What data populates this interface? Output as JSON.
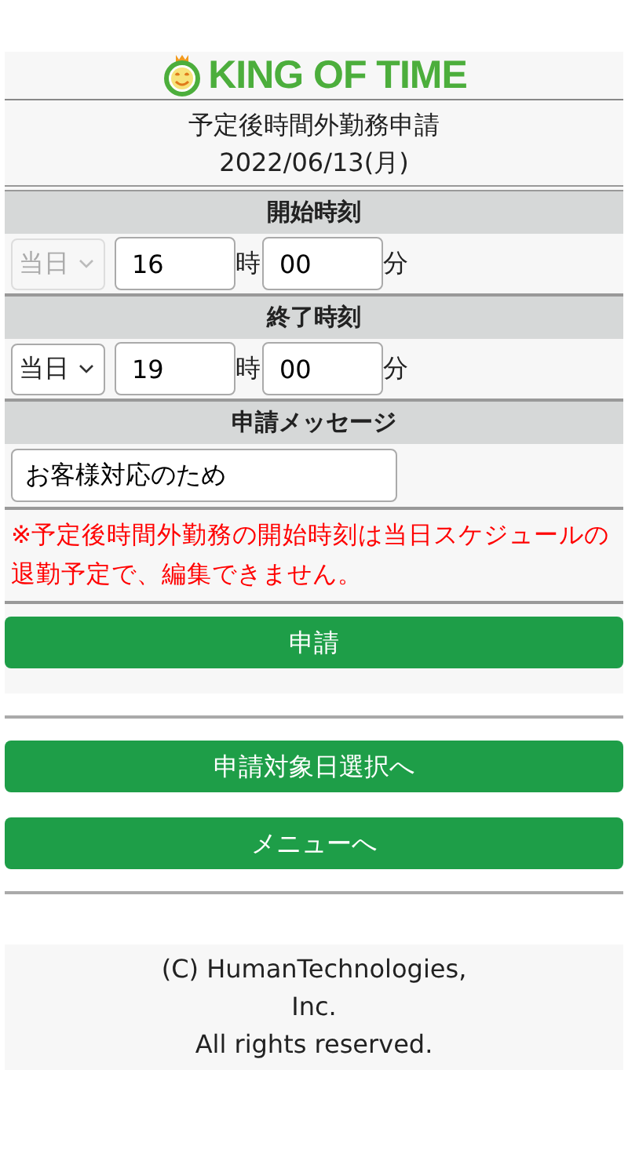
{
  "logo": {
    "text": "KING OF TIME"
  },
  "title": "予定後時間外勤務申請",
  "date": "2022/06/13(月)",
  "sections": [
    {
      "kind": "time",
      "heading": "開始時刻",
      "day": {
        "value": "当日",
        "disabled": true
      },
      "hour": "16",
      "hour_unit": "時",
      "minute": "00",
      "minute_unit": "分"
    },
    {
      "kind": "time",
      "heading": "終了時刻",
      "day": {
        "value": "当日",
        "disabled": false
      },
      "hour": "19",
      "hour_unit": "時",
      "minute": "00",
      "minute_unit": "分"
    },
    {
      "kind": "message",
      "heading": "申請メッセージ",
      "value": "お客様対応のため"
    }
  ],
  "notice": "※予定後時間外勤務の開始時刻は当日スケジュールの退勤予定で、編集できません。",
  "submit_button": "申請",
  "nav_buttons": [
    "申請対象日選択へ",
    "メニューへ"
  ],
  "footer": [
    "(C) HumanTechnologies,",
    "Inc.",
    "All rights reserved."
  ]
}
